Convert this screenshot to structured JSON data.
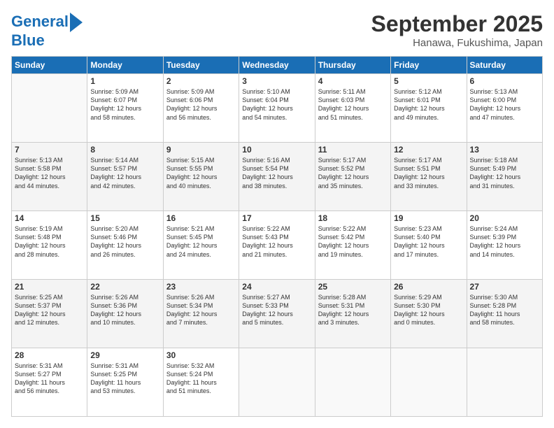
{
  "header": {
    "logo_line1": "General",
    "logo_line2": "Blue",
    "month": "September 2025",
    "location": "Hanawa, Fukushima, Japan"
  },
  "weekdays": [
    "Sunday",
    "Monday",
    "Tuesday",
    "Wednesday",
    "Thursday",
    "Friday",
    "Saturday"
  ],
  "weeks": [
    [
      {
        "day": "",
        "info": ""
      },
      {
        "day": "1",
        "info": "Sunrise: 5:09 AM\nSunset: 6:07 PM\nDaylight: 12 hours\nand 58 minutes."
      },
      {
        "day": "2",
        "info": "Sunrise: 5:09 AM\nSunset: 6:06 PM\nDaylight: 12 hours\nand 56 minutes."
      },
      {
        "day": "3",
        "info": "Sunrise: 5:10 AM\nSunset: 6:04 PM\nDaylight: 12 hours\nand 54 minutes."
      },
      {
        "day": "4",
        "info": "Sunrise: 5:11 AM\nSunset: 6:03 PM\nDaylight: 12 hours\nand 51 minutes."
      },
      {
        "day": "5",
        "info": "Sunrise: 5:12 AM\nSunset: 6:01 PM\nDaylight: 12 hours\nand 49 minutes."
      },
      {
        "day": "6",
        "info": "Sunrise: 5:13 AM\nSunset: 6:00 PM\nDaylight: 12 hours\nand 47 minutes."
      }
    ],
    [
      {
        "day": "7",
        "info": "Sunrise: 5:13 AM\nSunset: 5:58 PM\nDaylight: 12 hours\nand 44 minutes."
      },
      {
        "day": "8",
        "info": "Sunrise: 5:14 AM\nSunset: 5:57 PM\nDaylight: 12 hours\nand 42 minutes."
      },
      {
        "day": "9",
        "info": "Sunrise: 5:15 AM\nSunset: 5:55 PM\nDaylight: 12 hours\nand 40 minutes."
      },
      {
        "day": "10",
        "info": "Sunrise: 5:16 AM\nSunset: 5:54 PM\nDaylight: 12 hours\nand 38 minutes."
      },
      {
        "day": "11",
        "info": "Sunrise: 5:17 AM\nSunset: 5:52 PM\nDaylight: 12 hours\nand 35 minutes."
      },
      {
        "day": "12",
        "info": "Sunrise: 5:17 AM\nSunset: 5:51 PM\nDaylight: 12 hours\nand 33 minutes."
      },
      {
        "day": "13",
        "info": "Sunrise: 5:18 AM\nSunset: 5:49 PM\nDaylight: 12 hours\nand 31 minutes."
      }
    ],
    [
      {
        "day": "14",
        "info": "Sunrise: 5:19 AM\nSunset: 5:48 PM\nDaylight: 12 hours\nand 28 minutes."
      },
      {
        "day": "15",
        "info": "Sunrise: 5:20 AM\nSunset: 5:46 PM\nDaylight: 12 hours\nand 26 minutes."
      },
      {
        "day": "16",
        "info": "Sunrise: 5:21 AM\nSunset: 5:45 PM\nDaylight: 12 hours\nand 24 minutes."
      },
      {
        "day": "17",
        "info": "Sunrise: 5:22 AM\nSunset: 5:43 PM\nDaylight: 12 hours\nand 21 minutes."
      },
      {
        "day": "18",
        "info": "Sunrise: 5:22 AM\nSunset: 5:42 PM\nDaylight: 12 hours\nand 19 minutes."
      },
      {
        "day": "19",
        "info": "Sunrise: 5:23 AM\nSunset: 5:40 PM\nDaylight: 12 hours\nand 17 minutes."
      },
      {
        "day": "20",
        "info": "Sunrise: 5:24 AM\nSunset: 5:39 PM\nDaylight: 12 hours\nand 14 minutes."
      }
    ],
    [
      {
        "day": "21",
        "info": "Sunrise: 5:25 AM\nSunset: 5:37 PM\nDaylight: 12 hours\nand 12 minutes."
      },
      {
        "day": "22",
        "info": "Sunrise: 5:26 AM\nSunset: 5:36 PM\nDaylight: 12 hours\nand 10 minutes."
      },
      {
        "day": "23",
        "info": "Sunrise: 5:26 AM\nSunset: 5:34 PM\nDaylight: 12 hours\nand 7 minutes."
      },
      {
        "day": "24",
        "info": "Sunrise: 5:27 AM\nSunset: 5:33 PM\nDaylight: 12 hours\nand 5 minutes."
      },
      {
        "day": "25",
        "info": "Sunrise: 5:28 AM\nSunset: 5:31 PM\nDaylight: 12 hours\nand 3 minutes."
      },
      {
        "day": "26",
        "info": "Sunrise: 5:29 AM\nSunset: 5:30 PM\nDaylight: 12 hours\nand 0 minutes."
      },
      {
        "day": "27",
        "info": "Sunrise: 5:30 AM\nSunset: 5:28 PM\nDaylight: 11 hours\nand 58 minutes."
      }
    ],
    [
      {
        "day": "28",
        "info": "Sunrise: 5:31 AM\nSunset: 5:27 PM\nDaylight: 11 hours\nand 56 minutes."
      },
      {
        "day": "29",
        "info": "Sunrise: 5:31 AM\nSunset: 5:25 PM\nDaylight: 11 hours\nand 53 minutes."
      },
      {
        "day": "30",
        "info": "Sunrise: 5:32 AM\nSunset: 5:24 PM\nDaylight: 11 hours\nand 51 minutes."
      },
      {
        "day": "",
        "info": ""
      },
      {
        "day": "",
        "info": ""
      },
      {
        "day": "",
        "info": ""
      },
      {
        "day": "",
        "info": ""
      }
    ]
  ]
}
